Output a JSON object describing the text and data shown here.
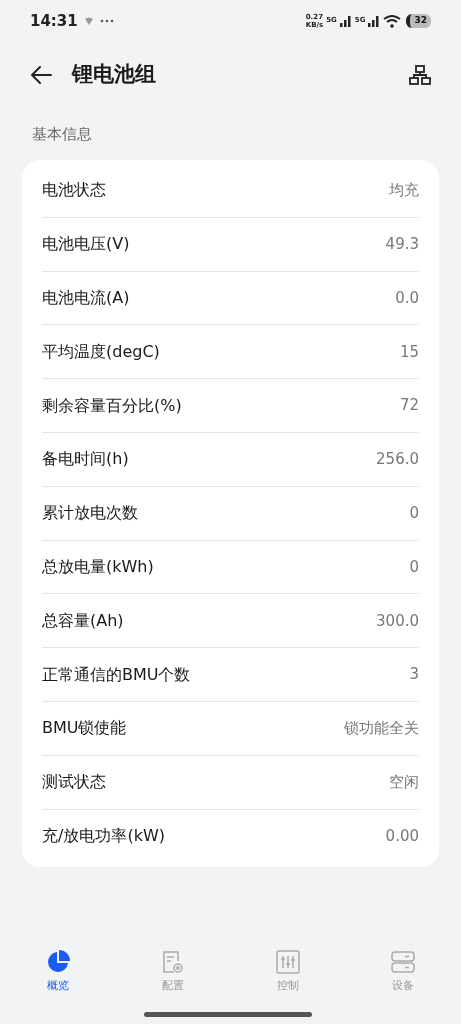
{
  "status_bar": {
    "time": "14:31",
    "net_speed": "0.27",
    "net_unit": "KB/s",
    "sim_1": "5G",
    "sim_2": "5G",
    "battery": "32"
  },
  "header": {
    "title": "锂电池组"
  },
  "section": {
    "title": "基本信息"
  },
  "rows": [
    {
      "label": "电池状态",
      "value": "均充"
    },
    {
      "label": "电池电压(V)",
      "value": "49.3"
    },
    {
      "label": "电池电流(A)",
      "value": "0.0"
    },
    {
      "label": "平均温度(degC)",
      "value": "15"
    },
    {
      "label": "剩余容量百分比(%)",
      "value": "72"
    },
    {
      "label": "备电时间(h)",
      "value": "256.0"
    },
    {
      "label": "累计放电次数",
      "value": "0"
    },
    {
      "label": "总放电量(kWh)",
      "value": "0"
    },
    {
      "label": "总容量(Ah)",
      "value": "300.0"
    },
    {
      "label": "正常通信的BMU个数",
      "value": "3"
    },
    {
      "label": "BMU锁使能",
      "value": "锁功能全关"
    },
    {
      "label": "测试状态",
      "value": "空闲"
    },
    {
      "label": "充/放电功率(kW)",
      "value": "0.00"
    }
  ],
  "nav": [
    {
      "kind": "overview",
      "label": "概览",
      "selected": true
    },
    {
      "kind": "config",
      "label": "配置",
      "selected": false
    },
    {
      "kind": "control",
      "label": "控制",
      "selected": false
    },
    {
      "kind": "device",
      "label": "设备",
      "selected": false
    }
  ]
}
